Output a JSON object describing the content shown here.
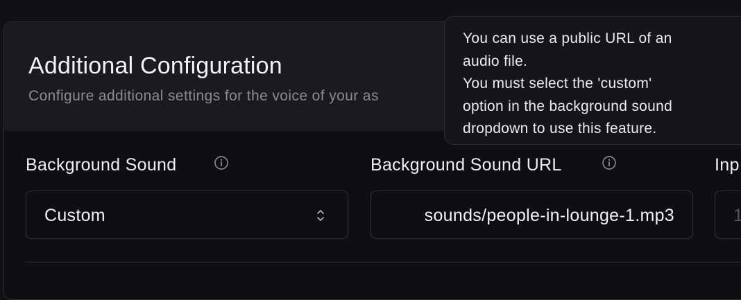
{
  "section": {
    "title": "Additional Configuration",
    "subtitle": "Configure additional settings for the voice of your as"
  },
  "fields": {
    "background_sound": {
      "label": "Background Sound",
      "value": "Custom"
    },
    "background_sound_url": {
      "label": "Background Sound URL",
      "value": "sounds/people-in-lounge-1.mp3"
    },
    "third_field": {
      "label": "Inp",
      "value": "1"
    }
  },
  "tooltip": {
    "text": "You can use a public URL of an\naudio file.\nYou must select the 'custom'\noption in the background sound\ndropdown to use this feature."
  },
  "colors": {
    "background": "#111113",
    "card_header": "#1b1b1e",
    "border": "#2e2e33",
    "text_primary": "#f2f2f4",
    "text_muted": "#8b8b93"
  }
}
